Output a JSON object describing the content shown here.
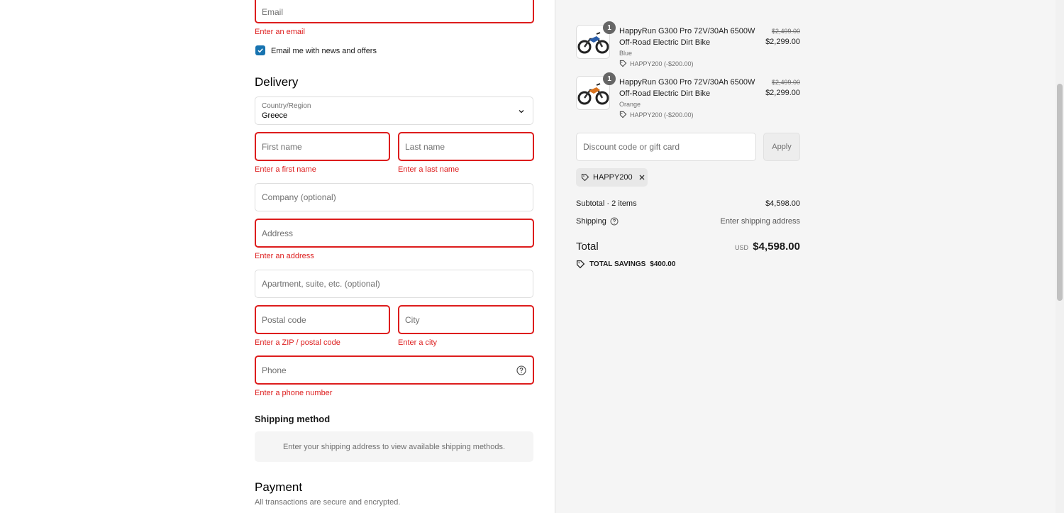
{
  "contact": {
    "email_placeholder": "Email",
    "email_error": "Enter an email",
    "newsletter_label": "Email me with news and offers"
  },
  "delivery": {
    "heading": "Delivery",
    "country_label": "Country/Region",
    "country_value": "Greece",
    "first_name_placeholder": "First name",
    "first_name_error": "Enter a first name",
    "last_name_placeholder": "Last name",
    "last_name_error": "Enter a last name",
    "company_placeholder": "Company (optional)",
    "address_placeholder": "Address",
    "address_error": "Enter an address",
    "apartment_placeholder": "Apartment, suite, etc. (optional)",
    "postal_placeholder": "Postal code",
    "postal_error": "Enter a ZIP / postal code",
    "city_placeholder": "City",
    "city_error": "Enter a city",
    "phone_placeholder": "Phone",
    "phone_error": "Enter a phone number"
  },
  "shipping_method": {
    "heading": "Shipping method",
    "message": "Enter your shipping address to view available shipping methods."
  },
  "payment": {
    "heading": "Payment",
    "subtitle": "All transactions are secure and encrypted."
  },
  "cart": {
    "items": [
      {
        "quantity": "1",
        "title_line1": "HappyRun G300 Pro 72V/30Ah 6500W",
        "title_line2": "Off-Road Electric Dirt Bike",
        "variant": "Blue",
        "discount": "HAPPY200 (-$200.00)",
        "original_price": "$2,499.00",
        "price": "$2,299.00",
        "accent": "#2a5da8"
      },
      {
        "quantity": "1",
        "title_line1": "HappyRun G300 Pro 72V/30Ah 6500W",
        "title_line2": "Off-Road Electric Dirt Bike",
        "variant": "Orange",
        "discount": "HAPPY200 (-$200.00)",
        "original_price": "$2,499.00",
        "price": "$2,299.00",
        "accent": "#d9731f"
      }
    ],
    "discount_placeholder": "Discount code or gift card",
    "apply_label": "Apply",
    "applied_code": "HAPPY200",
    "subtotal_label": "Subtotal · 2 items",
    "subtotal_value": "$4,598.00",
    "shipping_label": "Shipping",
    "shipping_value": "Enter shipping address",
    "total_label": "Total",
    "currency": "USD",
    "total_value": "$4,598.00",
    "savings_label": "TOTAL SAVINGS",
    "savings_value": "$400.00"
  },
  "colors": {
    "error": "#dd1d1d",
    "accent": "#1773b0"
  }
}
